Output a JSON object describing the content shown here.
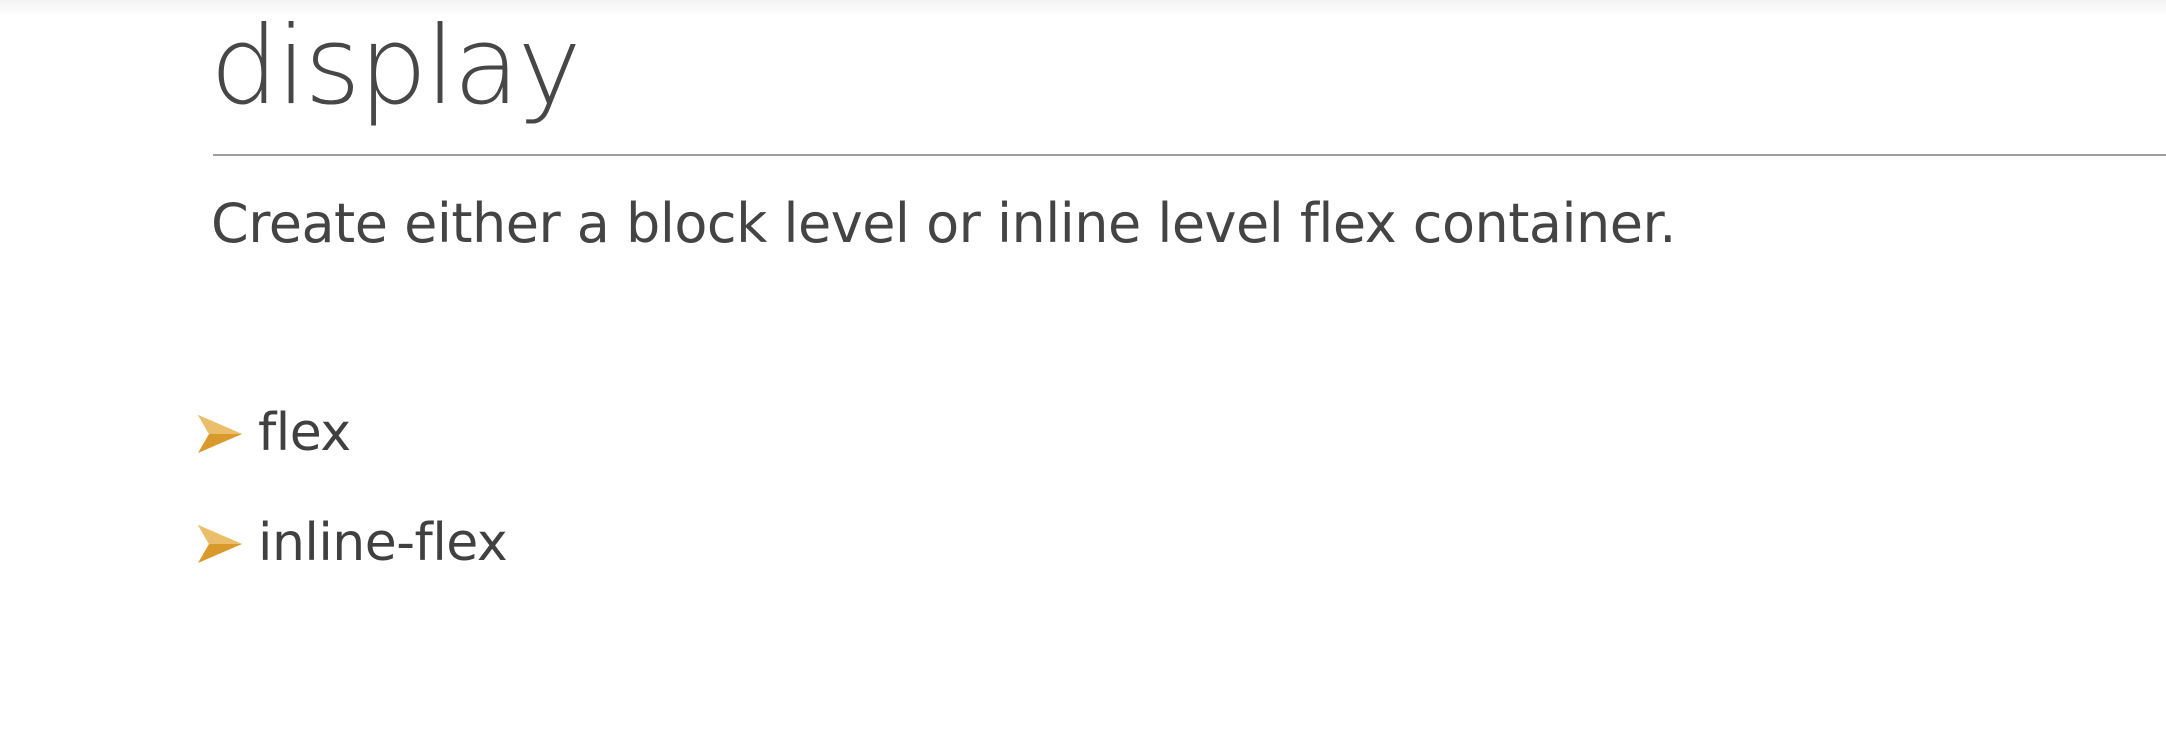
{
  "slide": {
    "title": "display",
    "subtitle": "Create either a block level or inline level flex container.",
    "bullets": [
      {
        "label": "flex"
      },
      {
        "label": "inline-flex"
      }
    ]
  },
  "colors": {
    "text": "#404040",
    "bullet_accent": "#D99A2B",
    "rule": "#9E9E9E"
  },
  "icons": {
    "bullet": "arrowhead-bullet-icon"
  }
}
